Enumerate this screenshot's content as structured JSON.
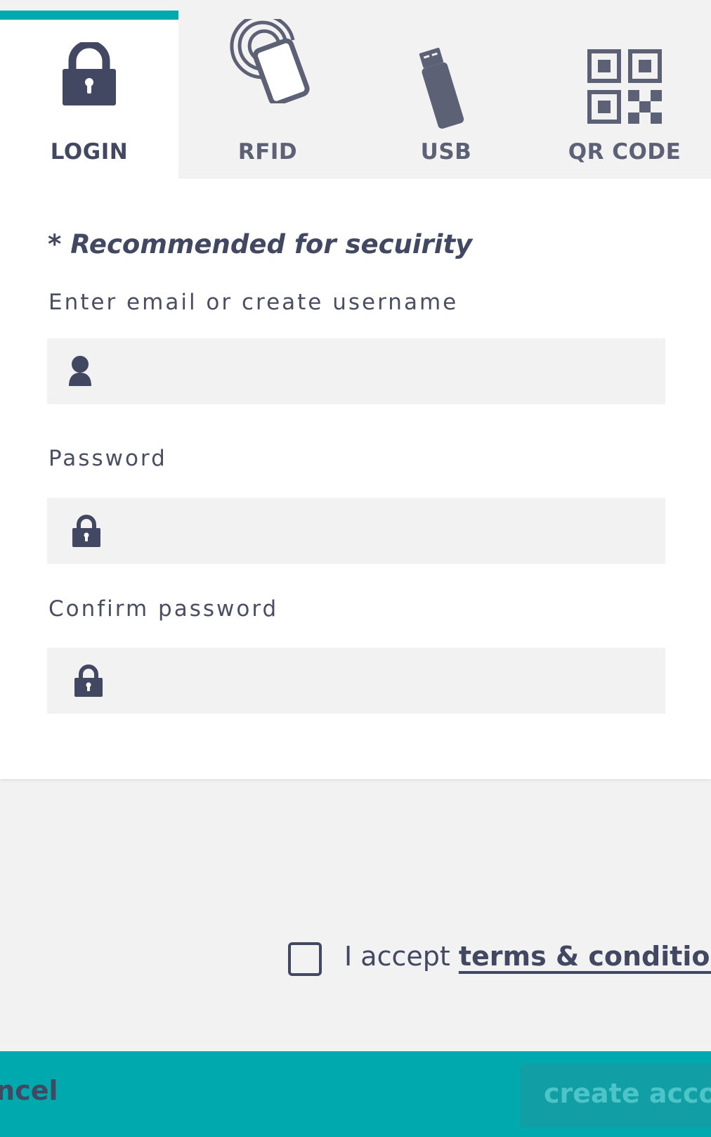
{
  "tabs": [
    {
      "label": "LOGIN",
      "icon": "padlock-icon",
      "active": true
    },
    {
      "label": "RFID",
      "icon": "rfid-card-icon",
      "active": false
    },
    {
      "label": "USB",
      "icon": "usb-stick-icon",
      "active": false
    },
    {
      "label": "QR CODE",
      "icon": "qr-code-icon",
      "active": false
    }
  ],
  "form": {
    "recommended": "* Recommended for secuirity",
    "username_label": "Enter email or create username",
    "username_value": "",
    "password_label": "Password",
    "password_value": "",
    "confirm_label": "Confirm password",
    "confirm_value": ""
  },
  "terms": {
    "prefix": "I accept ",
    "link": "terms & conditions",
    "checked": false
  },
  "footer": {
    "cancel_label": "cancel",
    "create_label": "create account"
  },
  "colors": {
    "accent": "#00a9ad",
    "text": "#434862",
    "field_bg": "#f2f2f2",
    "create_button_bg": "#119ea4",
    "create_button_text": "#4cc4c8"
  }
}
